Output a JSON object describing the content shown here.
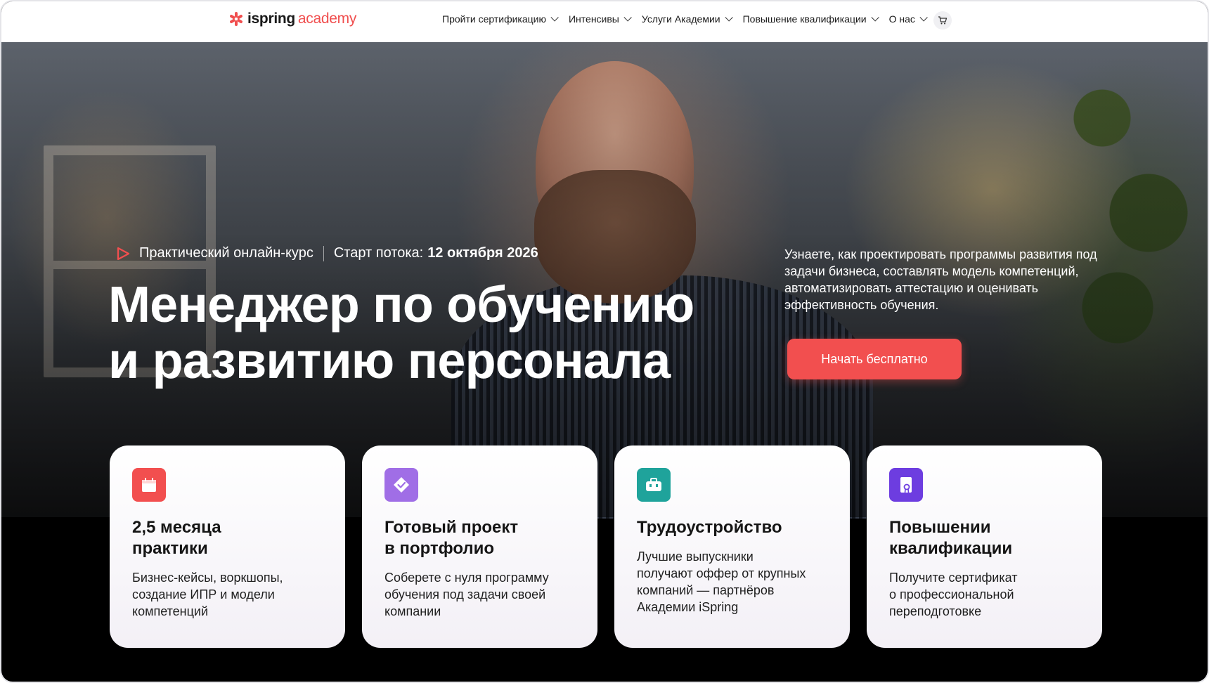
{
  "header": {
    "logo": {
      "part1": "ispring",
      "part2": "academy"
    },
    "nav": [
      {
        "label": "Пройти сертификацию"
      },
      {
        "label": "Интенсивы"
      },
      {
        "label": "Услуги Академии"
      },
      {
        "label": "Повышение квалификации"
      },
      {
        "label": "О нас"
      }
    ],
    "cart_icon": "cart-icon"
  },
  "hero": {
    "course_type": "Практический онлайн-курс",
    "start_label": "Старт потока:",
    "start_date": "12 октября 2026",
    "title_line1": "Менеджер по обучению",
    "title_line2": "и развитию персонала",
    "description": "Узнаете, как проектировать программы развития под задачи бизнеса, составлять модель компетенций, автоматизировать аттестацию и оценивать эффективность обучения.",
    "cta_label": "Начать бесплатно"
  },
  "cards": [
    {
      "icon": "calendar-icon",
      "color": "#f24f4f",
      "title": "2,5 месяца\nпрактики",
      "text": "Бизнес-кейсы, воркшопы,\nсоздание ИПР и модели\nкомпетенций"
    },
    {
      "icon": "check-diamond-icon",
      "color": "#a06ee6",
      "title": "Готовый проект\nв портфолио",
      "text": "Соберете с нуля программу\nобучения под задачи своей\nкомпании"
    },
    {
      "icon": "briefcase-icon",
      "color": "#1fa39b",
      "title": "Трудоустройство",
      "text": "Лучшие выпускники\nполучают оффер от крупных\nкомпаний — партнёров\nАкадемии iSpring"
    },
    {
      "icon": "certificate-icon",
      "color": "#6d3de0",
      "title": "Повышении\nквалификации",
      "text": "Получите сертификат\nо профессиональной\nпереподготовке"
    }
  ],
  "colors": {
    "accent": "#f24f4f",
    "dark": "#1a1a1a"
  }
}
